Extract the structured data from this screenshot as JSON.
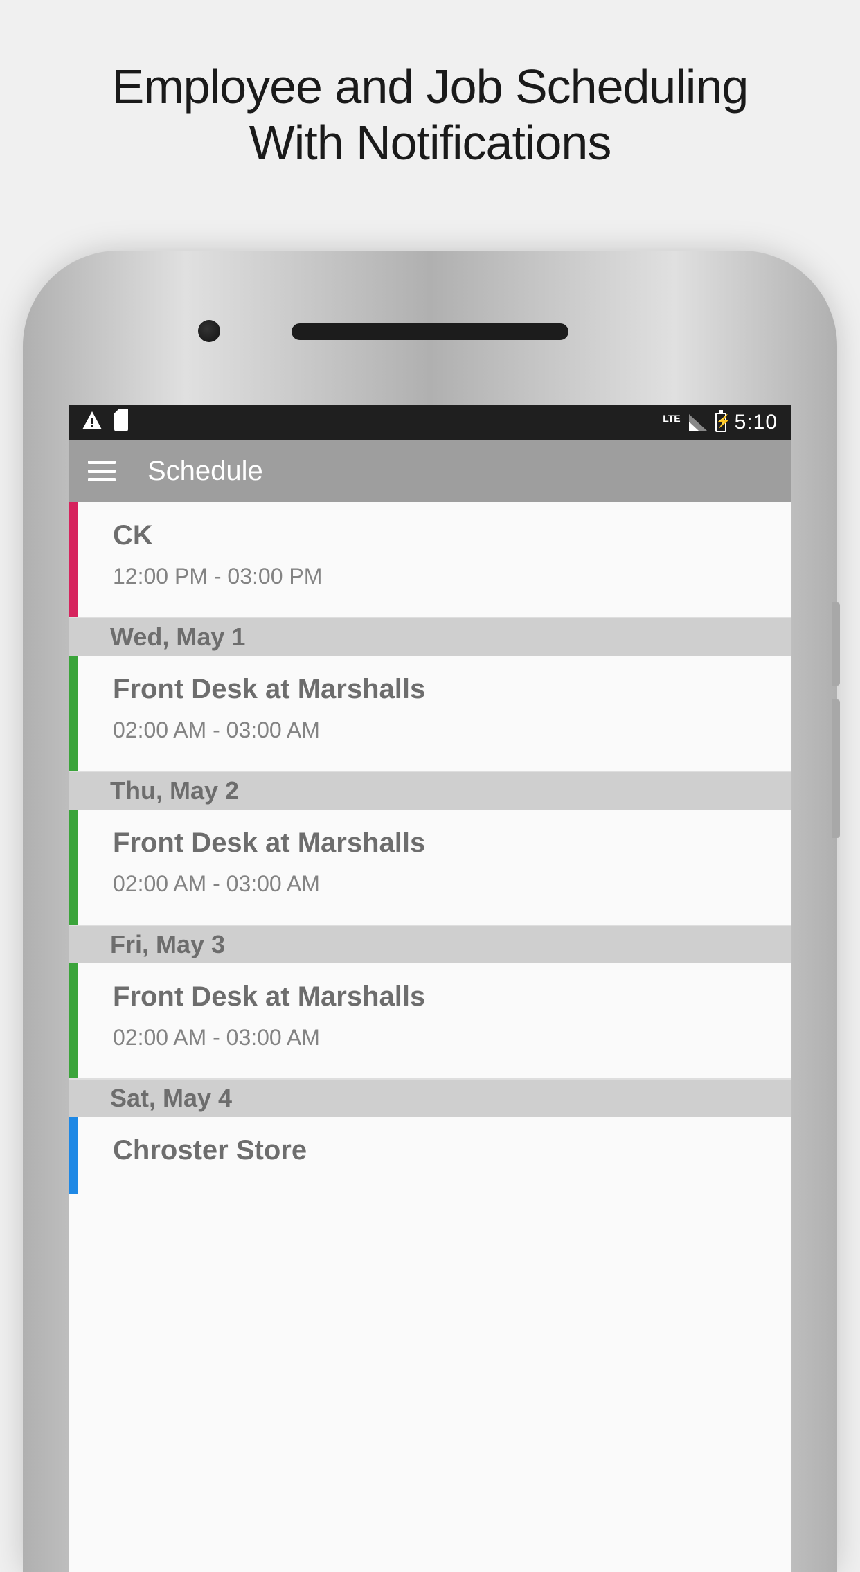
{
  "promo": {
    "line1": "Employee and Job Scheduling",
    "line2": "With Notifications"
  },
  "status_bar": {
    "time": "5:10",
    "network": "LTE"
  },
  "app_bar": {
    "title": "Schedule"
  },
  "schedule": {
    "first_event": {
      "title": "CK",
      "time": "12:00 PM - 03:00 PM",
      "color": "#d6235d"
    },
    "days": [
      {
        "header": "Wed, May 1",
        "events": [
          {
            "title": "Front Desk at Marshalls",
            "time": "02:00 AM - 03:00 AM",
            "color": "#3aa43a"
          }
        ]
      },
      {
        "header": "Thu, May 2",
        "events": [
          {
            "title": "Front Desk at Marshalls",
            "time": "02:00 AM - 03:00 AM",
            "color": "#3aa43a"
          }
        ]
      },
      {
        "header": "Fri, May 3",
        "events": [
          {
            "title": "Front Desk at Marshalls",
            "time": "02:00 AM - 03:00 AM",
            "color": "#3aa43a"
          }
        ]
      },
      {
        "header": "Sat, May 4",
        "events": [
          {
            "title": "Chroster Store",
            "time": "",
            "color": "#1e88e5"
          }
        ]
      }
    ]
  }
}
